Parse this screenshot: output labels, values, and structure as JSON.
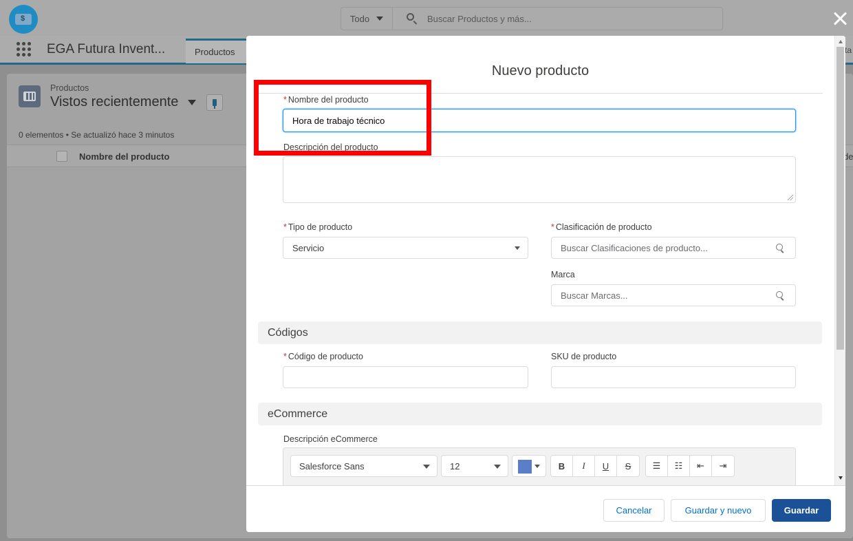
{
  "app": {
    "name": "EGA Futura Invent...",
    "nav_tab": "Productos",
    "nav_right_fragment": "ta"
  },
  "global_search": {
    "scope": "Todo",
    "placeholder": "Buscar Productos y más..."
  },
  "list_view": {
    "object_label": "Productos",
    "view_name": "Vistos recientemente",
    "meta": "0 elementos • Se actualizó hace 3 minutos",
    "column_header": "Nombre del producto",
    "right_column_fragment": "de"
  },
  "modal": {
    "title": "Nuevo producto",
    "fields": {
      "product_name": {
        "label": "Nombre del producto",
        "value": "Hora de trabajo técnico",
        "required": true
      },
      "description": {
        "label": "Descripción del producto",
        "value": ""
      },
      "product_type": {
        "label": "Tipo de producto",
        "value": "Servicio",
        "required": true
      },
      "classification": {
        "label": "Clasificación de producto",
        "placeholder": "Buscar Clasificaciones de producto...",
        "required": true
      },
      "brand": {
        "label": "Marca",
        "placeholder": "Buscar Marcas..."
      },
      "product_code": {
        "label": "Código de producto",
        "value": "",
        "required": true
      },
      "sku": {
        "label": "SKU de producto",
        "value": ""
      },
      "ecommerce_description": {
        "label": "Descripción eCommerce"
      }
    },
    "sections": {
      "codes": "Códigos",
      "ecommerce": "eCommerce"
    },
    "rich_text": {
      "font": "Salesforce Sans",
      "size": "12",
      "color": "#5a7ec7",
      "bold": "B",
      "italic": "I",
      "underline": "U",
      "strike": "S",
      "bullets": "☰",
      "numbered": "☷",
      "outdent": "⇤",
      "indent": "⇥"
    },
    "buttons": {
      "cancel": "Cancelar",
      "save_new": "Guardar y nuevo",
      "save": "Guardar"
    }
  },
  "colors": {
    "brand": "#1b5297",
    "highlight": "#ff0000",
    "focus": "#1b96ff",
    "required": "#c23934"
  }
}
